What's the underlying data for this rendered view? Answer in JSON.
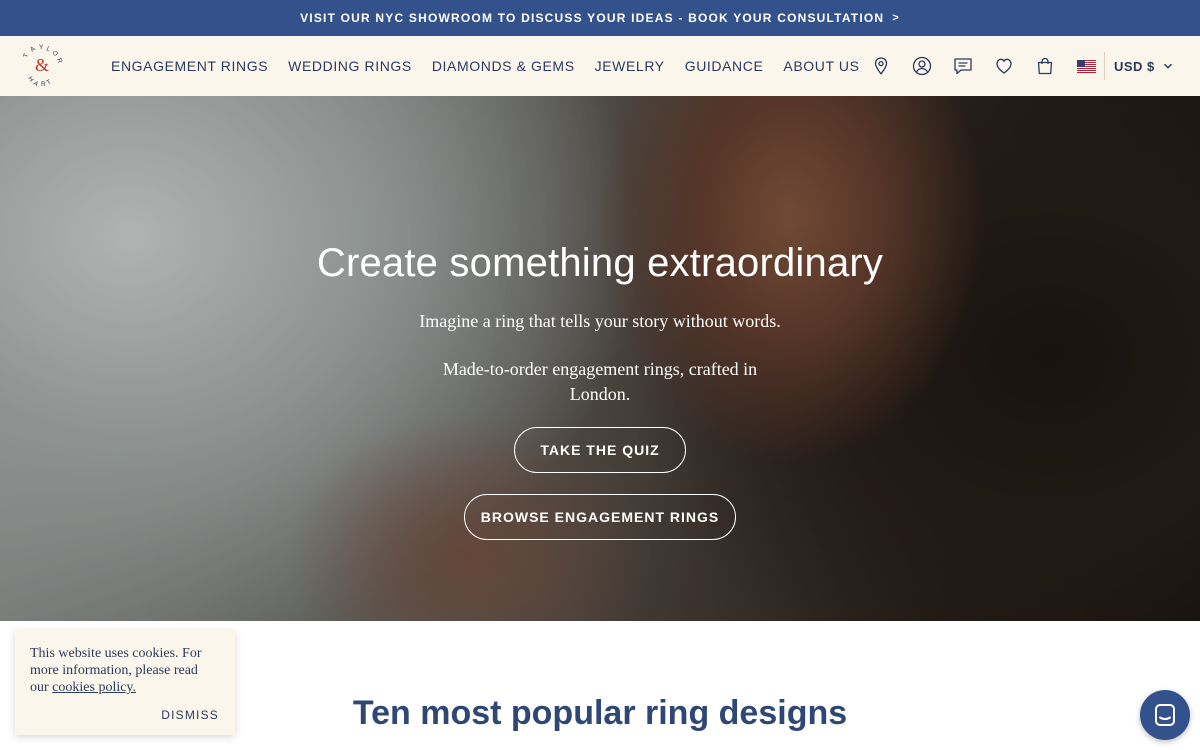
{
  "announcement": {
    "text": "VISIT OUR NYC SHOWROOM TO DISCUSS YOUR IDEAS - BOOK YOUR CONSULTATION",
    "chevron": ">"
  },
  "header": {
    "logo_text": "TAYLOR & HART",
    "nav": [
      {
        "label": "ENGAGEMENT RINGS"
      },
      {
        "label": "WEDDING RINGS"
      },
      {
        "label": "DIAMONDS & GEMS"
      },
      {
        "label": "JEWELRY"
      },
      {
        "label": "GUIDANCE"
      },
      {
        "label": "ABOUT US"
      }
    ],
    "icons": [
      "location-pin-icon",
      "account-icon",
      "chat-icon",
      "heart-icon",
      "bag-icon"
    ],
    "flag": "us-flag-icon",
    "currency": "USD $"
  },
  "hero": {
    "title": "Create something extraordinary",
    "subtitle": "Imagine a ring that tells your story without words.",
    "subtitle2": "Made-to-order engagement rings, crafted in London.",
    "quiz_button": "TAKE THE QUIZ",
    "browse_button": "BROWSE ENGAGEMENT RINGS"
  },
  "section": {
    "title": "Ten most popular ring designs"
  },
  "cookie": {
    "text_before": "This website uses cookies. For more information, please read our ",
    "link": "cookies policy.",
    "dismiss": "DISMISS"
  },
  "colors": {
    "announce_bg": "#33518a",
    "header_bg": "#fbf6ec",
    "text_navy": "#2b3a5c",
    "accent_red": "#c0392b"
  }
}
